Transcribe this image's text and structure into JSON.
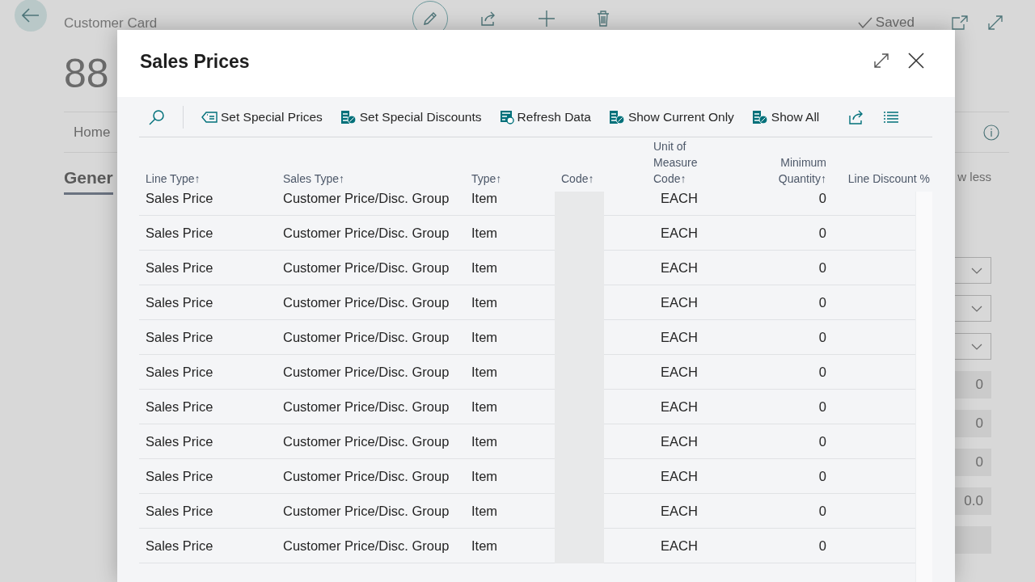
{
  "background_page": {
    "title": "Customer Card",
    "heading": "88",
    "status": "Saved",
    "tabs": [
      {
        "label": "Home",
        "selected": false
      }
    ],
    "section": "Gener",
    "section_toggle": "w less",
    "fields": [
      {
        "kind": "dropdown"
      },
      {
        "kind": "dropdown"
      },
      {
        "kind": "dropdown"
      },
      {
        "kind": "number",
        "value": "0"
      },
      {
        "kind": "number",
        "value": "0"
      },
      {
        "kind": "number",
        "value": "0"
      },
      {
        "kind": "number",
        "value": "0.0"
      },
      {
        "kind": "number"
      }
    ]
  },
  "dialog": {
    "title": "Sales Prices",
    "actions": [
      {
        "label": "Set Special Prices"
      },
      {
        "label": "Set Special Discounts"
      },
      {
        "label": "Refresh Data"
      },
      {
        "label": "Show Current Only"
      },
      {
        "label": "Show All"
      }
    ],
    "columns": [
      {
        "label": "Line Type",
        "sort_mark": "↑"
      },
      {
        "label": "Sales Type",
        "sort_mark": "↑"
      },
      {
        "label": "Type",
        "sort_mark": "↑"
      },
      {
        "label": "Code",
        "sort_mark": "↑"
      },
      {
        "label": "Unit of Measure Code",
        "sort_mark": "↑"
      },
      {
        "label": "Minimum Quantity",
        "sort_mark": "↑"
      },
      {
        "label": "Line Discount %"
      }
    ],
    "rows": [
      {
        "line_type": "Sales Price",
        "sales_type": "Customer Price/Disc. Group",
        "type": "Item",
        "unit_of_measure_code": "EACH",
        "minimum_quantity": "0"
      },
      {
        "line_type": "Sales Price",
        "sales_type": "Customer Price/Disc. Group",
        "type": "Item",
        "unit_of_measure_code": "EACH",
        "minimum_quantity": "0"
      },
      {
        "line_type": "Sales Price",
        "sales_type": "Customer Price/Disc. Group",
        "type": "Item",
        "unit_of_measure_code": "EACH",
        "minimum_quantity": "0"
      },
      {
        "line_type": "Sales Price",
        "sales_type": "Customer Price/Disc. Group",
        "type": "Item",
        "unit_of_measure_code": "EACH",
        "minimum_quantity": "0"
      },
      {
        "line_type": "Sales Price",
        "sales_type": "Customer Price/Disc. Group",
        "type": "Item",
        "unit_of_measure_code": "EACH",
        "minimum_quantity": "0"
      },
      {
        "line_type": "Sales Price",
        "sales_type": "Customer Price/Disc. Group",
        "type": "Item",
        "unit_of_measure_code": "EACH",
        "minimum_quantity": "0"
      },
      {
        "line_type": "Sales Price",
        "sales_type": "Customer Price/Disc. Group",
        "type": "Item",
        "unit_of_measure_code": "EACH",
        "minimum_quantity": "0"
      },
      {
        "line_type": "Sales Price",
        "sales_type": "Customer Price/Disc. Group",
        "type": "Item",
        "unit_of_measure_code": "EACH",
        "minimum_quantity": "0"
      },
      {
        "line_type": "Sales Price",
        "sales_type": "Customer Price/Disc. Group",
        "type": "Item",
        "unit_of_measure_code": "EACH",
        "minimum_quantity": "0"
      },
      {
        "line_type": "Sales Price",
        "sales_type": "Customer Price/Disc. Group",
        "type": "Item",
        "unit_of_measure_code": "EACH",
        "minimum_quantity": "0"
      },
      {
        "line_type": "Sales Price",
        "sales_type": "Customer Price/Disc. Group",
        "type": "Item",
        "unit_of_measure_code": "EACH",
        "minimum_quantity": "0"
      }
    ]
  }
}
